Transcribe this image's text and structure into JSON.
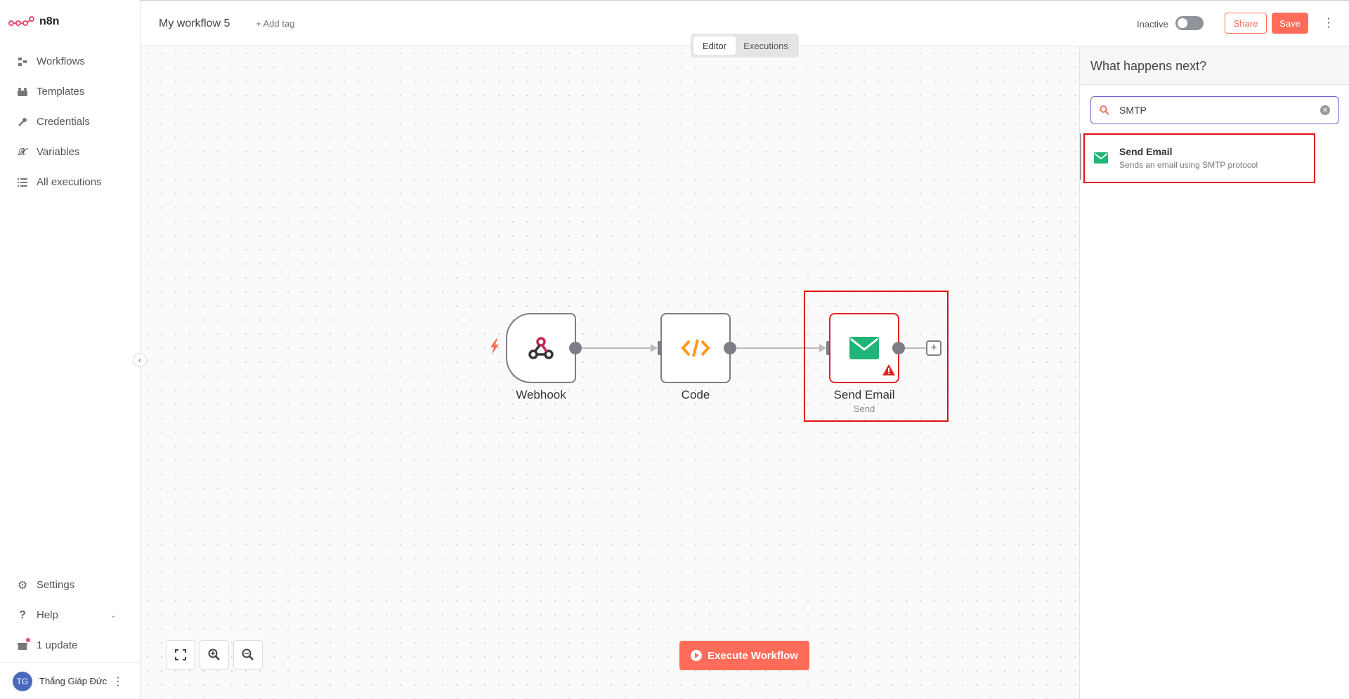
{
  "app": {
    "logo_text": "n8n"
  },
  "sidebar": {
    "items": [
      {
        "label": "Workflows",
        "icon": "workflows-icon"
      },
      {
        "label": "Templates",
        "icon": "templates-icon"
      },
      {
        "label": "Credentials",
        "icon": "key-icon"
      },
      {
        "label": "Variables",
        "icon": "variables-icon"
      },
      {
        "label": "All executions",
        "icon": "list-icon"
      }
    ],
    "bottom": {
      "settings": "Settings",
      "help": "Help",
      "update": "1 update"
    },
    "user": {
      "initials": "TG",
      "name": "Thắng Giáp Đức"
    }
  },
  "topbar": {
    "workflow_name": "My workflow 5",
    "add_tag": "+ Add tag",
    "status": "Inactive",
    "share": "Share",
    "save": "Save"
  },
  "tabs": {
    "editor": "Editor",
    "executions": "Executions"
  },
  "nodes": [
    {
      "label": "Webhook"
    },
    {
      "label": "Code"
    },
    {
      "label": "Send Email",
      "subtitle": "Send"
    }
  ],
  "execute_button": "Execute Workflow",
  "panel": {
    "title": "What happens next?",
    "search_value": "SMTP",
    "result": {
      "title": "Send Email",
      "description": "Sends an email using SMTP protocol"
    }
  },
  "colors": {
    "accent": "#ff6d5a",
    "node_border": "#7d7d87",
    "error": "#e02424",
    "email_green": "#1fb577",
    "code_orange": "#ff9922"
  }
}
